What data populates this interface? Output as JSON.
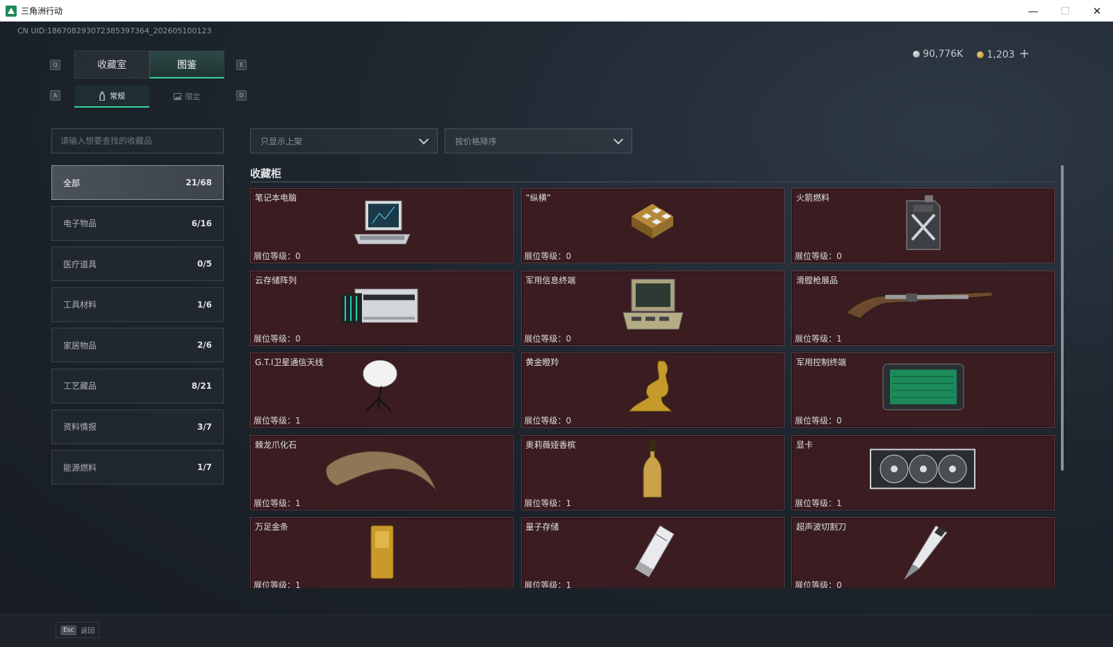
{
  "window": {
    "title": "三角洲行动",
    "minimize": "—",
    "maximize": "☐",
    "close": "✕"
  },
  "header": {
    "uid": "CN UID:18670829307238539736​4_202605100123",
    "currency": [
      {
        "icon": "silver-coin-icon",
        "value": "90,776K"
      },
      {
        "icon": "gold-coin-icon",
        "value": "1,203"
      }
    ],
    "add_symbol": "+"
  },
  "hotkeys": {
    "q": "Q",
    "e": "E",
    "a": "A",
    "d": "D"
  },
  "tabs": [
    "收藏室",
    "图鉴"
  ],
  "active_tab": 1,
  "subtabs": [
    "常规",
    "限定"
  ],
  "active_subtab": 0,
  "search": {
    "placeholder": "请输入想要查找的收藏品"
  },
  "filters": {
    "shelf": "只显示上架",
    "sort": "按价格降序"
  },
  "categories": [
    {
      "label": "全部",
      "count": "21/68"
    },
    {
      "label": "电子物品",
      "count": "6/16"
    },
    {
      "label": "医疗道具",
      "count": "0/5"
    },
    {
      "label": "工具材料",
      "count": "1/6"
    },
    {
      "label": "家居物品",
      "count": "2/6"
    },
    {
      "label": "工艺藏品",
      "count": "8/21"
    },
    {
      "label": "资料情报",
      "count": "3/7"
    },
    {
      "label": "能源燃料",
      "count": "1/7"
    }
  ],
  "cabinet": {
    "title": "收藏柜",
    "level_label": "展位等级："
  },
  "items": [
    {
      "name": "笔记本电脑",
      "level": "0",
      "icon": "laptop"
    },
    {
      "name": "“纵横”",
      "level": "0",
      "icon": "chess-board"
    },
    {
      "name": "火箭燃料",
      "level": "0",
      "icon": "fuel-canister"
    },
    {
      "name": "云存储阵列",
      "level": "0",
      "icon": "storage-array"
    },
    {
      "name": "军用信息终端",
      "level": "0",
      "icon": "field-terminal"
    },
    {
      "name": "滑膛枪展品",
      "level": "1",
      "icon": "musket"
    },
    {
      "name": "G.T.I卫星通信天线",
      "level": "1",
      "icon": "satellite-dish"
    },
    {
      "name": "黄金瞪羚",
      "level": "0",
      "icon": "golden-gazelle"
    },
    {
      "name": "军用控制终端",
      "level": "0",
      "icon": "control-terminal"
    },
    {
      "name": "棘龙爪化石",
      "level": "1",
      "icon": "claw-fossil"
    },
    {
      "name": "奥莉薇娅香槟",
      "level": "1",
      "icon": "champagne"
    },
    {
      "name": "显卡",
      "level": "1",
      "icon": "graphics-card"
    },
    {
      "name": "万足金条",
      "level": "1",
      "icon": "gold-bar"
    },
    {
      "name": "量子存储",
      "level": "1",
      "icon": "usb-drive"
    },
    {
      "name": "超声波切割刀",
      "level": "0",
      "icon": "ultrasonic-cutter"
    }
  ],
  "footer": {
    "esc_key": "Esc",
    "back": "返回"
  },
  "colors": {
    "accent": "#3fd39a",
    "card_bg": "#3a1c21",
    "card_border": "#6b3a40"
  }
}
